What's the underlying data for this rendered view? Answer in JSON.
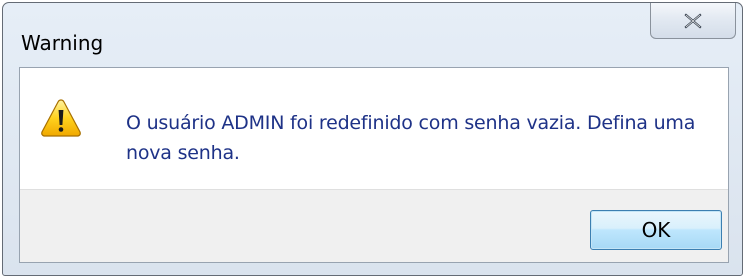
{
  "dialog": {
    "title": "Warning",
    "icon": "warning-icon",
    "message": "O usuário ADMIN foi redefinido com senha vazia. Defina uma nova senha.",
    "close_icon": "close-icon",
    "buttons": {
      "ok_label": "OK"
    }
  },
  "colors": {
    "message_text": "#1e3287",
    "button_border": "#3c7fb1",
    "footer_bg": "#f0f0f0",
    "warning_fill": "#f5c400"
  }
}
